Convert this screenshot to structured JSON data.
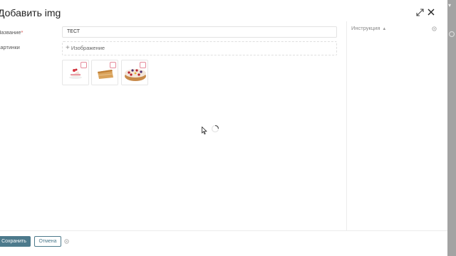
{
  "modal": {
    "title": "Добавить img",
    "icons": {
      "expand": "expand-icon",
      "close": "close-icon"
    }
  },
  "form": {
    "name_label": "Название",
    "name_required_mark": "*",
    "name_value": "ТЕСТ",
    "pictures_label": "Картинки",
    "add_image_label": "Изображение",
    "thumbnails": [
      {
        "subject": "strawberry cake slice"
      },
      {
        "subject": "layered honey cake slice"
      },
      {
        "subject": "round berry cake"
      }
    ]
  },
  "sidebar": {
    "instruction_label": "Инструкция"
  },
  "footer": {
    "save_label": "Сохранить",
    "cancel_label": "Отмена"
  },
  "colors": {
    "primary": "#4d7a8c",
    "required": "#d9534f",
    "delete_badge": "#e58b9b",
    "backdrop": "#9a9a9a"
  }
}
